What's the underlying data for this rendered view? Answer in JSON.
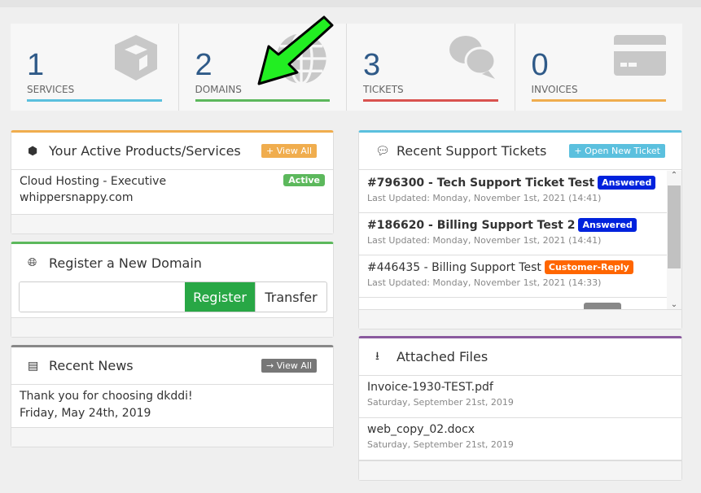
{
  "tiles": [
    {
      "value": "1",
      "label": "SERVICES",
      "color": "#5bc0de",
      "icon": "cube-icon"
    },
    {
      "value": "2",
      "label": "DOMAINS",
      "color": "#5cb85c",
      "icon": "globe-icon"
    },
    {
      "value": "3",
      "label": "TICKETS",
      "color": "#d9534f",
      "icon": "comments-icon"
    },
    {
      "value": "0",
      "label": "INVOICES",
      "color": "#f0ad4e",
      "icon": "credit-card-icon"
    }
  ],
  "products": {
    "title": "Your Active Products/Services",
    "view_all": "+ View All",
    "item_name": "Cloud Hosting - Executive",
    "item_domain": "whippersnappy.com",
    "status": "Active",
    "color": "#f0ad4e"
  },
  "domain": {
    "title": "Register a New Domain",
    "input_value": "",
    "register": "Register",
    "transfer": "Transfer",
    "color": "#5cb85c"
  },
  "news": {
    "title": "Recent News",
    "view_all": "→ View All",
    "item": "Thank you for choosing dkddi!",
    "date": "Friday, May 24th, 2019",
    "color": "#888888"
  },
  "tickets": {
    "title": "Recent Support Tickets",
    "open_new": "+ Open New Ticket",
    "color": "#5bc0de",
    "items": [
      {
        "subject": "#796300 - Tech Support Ticket Test",
        "status": "Answered",
        "status_color": "#0022dd",
        "updated": "Last Updated: Monday, November 1st, 2021 (14:41)",
        "bold": true
      },
      {
        "subject": "#186620 - Billing Support Test 2",
        "status": "Answered",
        "status_color": "#0022dd",
        "updated": "Last Updated: Monday, November 1st, 2021 (14:41)",
        "bold": true
      },
      {
        "subject": "#446435 - Billing Support Test",
        "status": "Customer-Reply",
        "status_color": "#ff6600",
        "updated": "Last Updated: Monday, November 1st, 2021 (14:33)",
        "bold": false
      }
    ]
  },
  "files": {
    "title": "Attached Files",
    "color": "#8a5a9e",
    "items": [
      {
        "name": "Invoice-1930-TEST.pdf",
        "date": "Saturday, September 21st, 2019"
      },
      {
        "name": "web_copy_02.docx",
        "date": "Saturday, September 21st, 2019"
      }
    ]
  }
}
